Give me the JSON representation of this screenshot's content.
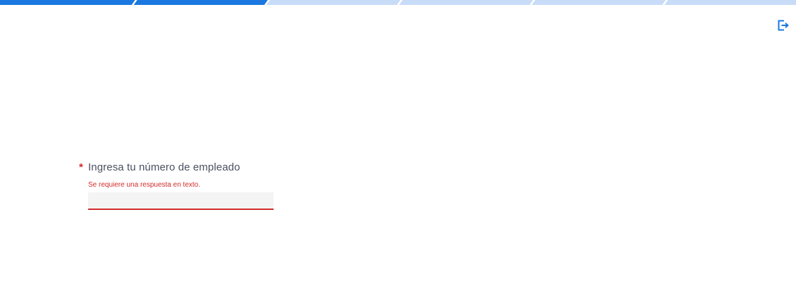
{
  "progress": {
    "completed_fraction": 0.333,
    "segments": 6,
    "segments_completed": 2,
    "active_color": "#1a78e0",
    "inactive_color": "#c8dcf7"
  },
  "header": {
    "exit_icon": "exit-icon",
    "exit_icon_color": "#1a78e0"
  },
  "question": {
    "required_mark": "*",
    "title": "Ingresa tu número de empleado",
    "error": "Se requiere una respuesta en texto.",
    "input_value": "",
    "error_color": "#d22b2b"
  }
}
